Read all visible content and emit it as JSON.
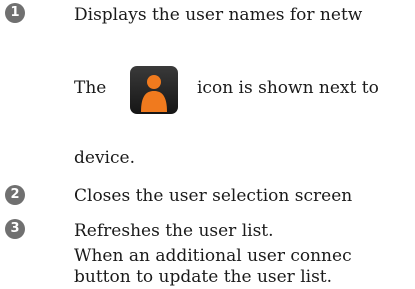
{
  "items": [
    {
      "number": "1",
      "lines": [
        "Displays the user names for netw",
        "The",
        "icon is shown next to",
        "device."
      ],
      "icon": "user-person-orange-icon"
    },
    {
      "number": "2",
      "lines": [
        "Closes the user selection screen"
      ]
    },
    {
      "number": "3",
      "lines": [
        "Refreshes the user list.",
        "When an additional user connec",
        "button to update the user list."
      ]
    }
  ],
  "colors": {
    "badge": "#707070",
    "icon_background": "#1e1e1e",
    "icon_person": "#f07a1e"
  }
}
